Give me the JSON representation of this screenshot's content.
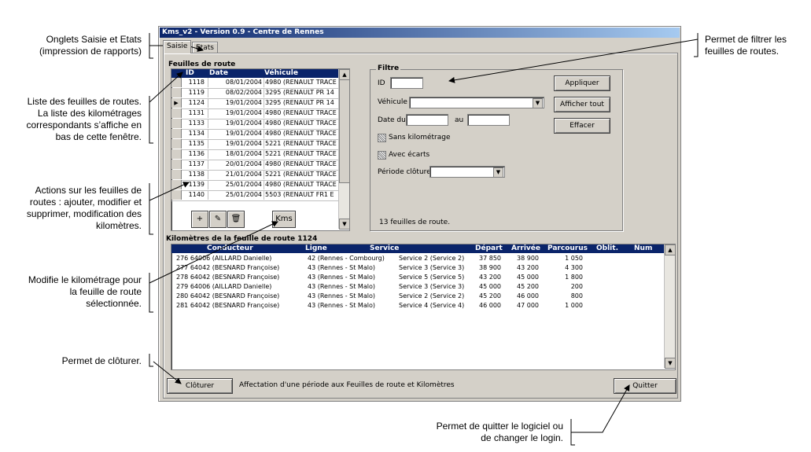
{
  "callouts": {
    "onglets": [
      "Onglets Saisie et Etats",
      "(impression de rapports)"
    ],
    "liste": [
      "Liste des feuilles de routes.",
      "La liste des kilométrages",
      "correspondants s’affiche en",
      "bas de cette fenêtre."
    ],
    "actions": [
      "Actions sur les feuilles de",
      "routes : ajouter, modifier et",
      "supprimer, modification des",
      "kilomètres."
    ],
    "modifie": [
      "Modifie le kilométrage pour",
      "la feuille de route",
      "sélectionnée."
    ],
    "cloturer": [
      "Permet de clôturer."
    ],
    "filtrer": [
      "Permet de filtrer les",
      "feuilles de routes."
    ],
    "quitter": [
      "Permet de quitter le logiciel ou",
      "de changer le login."
    ]
  },
  "window": {
    "title": "Kms_v2 - Version 0.9 - Centre de Rennes",
    "tabs": [
      "Saisie",
      "Etats"
    ]
  },
  "feuilles": {
    "title": "Feuilles de route",
    "columns": [
      "ID",
      "Date",
      "Véhicule"
    ],
    "rows": [
      {
        "id": "1118",
        "date": "08/01/2004",
        "vehicule": "4980 (RENAULT TRACE"
      },
      {
        "id": "1119",
        "date": "08/02/2004",
        "vehicule": "3295 (RENAULT PR 14"
      },
      {
        "id": "1124",
        "date": "19/01/2004",
        "vehicule": "3295 (RENAULT PR 14"
      },
      {
        "id": "1131",
        "date": "19/01/2004",
        "vehicule": "4980 (RENAULT TRACE"
      },
      {
        "id": "1133",
        "date": "19/01/2004",
        "vehicule": "4980 (RENAULT TRACE"
      },
      {
        "id": "1134",
        "date": "19/01/2004",
        "vehicule": "4980 (RENAULT TRACE"
      },
      {
        "id": "1135",
        "date": "19/01/2004",
        "vehicule": "5221 (RENAULT TRACE"
      },
      {
        "id": "1136",
        "date": "18/01/2004",
        "vehicule": "5221 (RENAULT TRACE"
      },
      {
        "id": "1137",
        "date": "20/01/2004",
        "vehicule": "4980 (RENAULT TRACE"
      },
      {
        "id": "1138",
        "date": "21/01/2004",
        "vehicule": "5221 (RENAULT TRACE"
      },
      {
        "id": "1139",
        "date": "25/01/2004",
        "vehicule": "4980 (RENAULT TRACE"
      },
      {
        "id": "1140",
        "date": "25/01/2004",
        "vehicule": "5503 (RENAULT FR1 E"
      }
    ],
    "tools": {
      "add": "+",
      "edit": "✎",
      "delete": "🗑",
      "kms": "Kms"
    }
  },
  "filtre": {
    "title": "Filtre",
    "id_label": "ID",
    "vehicule_label": "Véhicule",
    "date_du_label": "Date du",
    "au_label": "au",
    "sans_km": "Sans kilométrage",
    "avec_ecarts": "Avec écarts",
    "periode_label": "Période clôture",
    "count": "13 feuilles de route.",
    "appliquer": "Appliquer",
    "afficher_tout": "Afficher tout",
    "effacer": "Effacer"
  },
  "km": {
    "title": "Kilomètres de la feuille de route 1124",
    "columns": [
      "Conducteur",
      "Ligne",
      "Service",
      "Départ",
      "Arrivée",
      "Parcourus",
      "Oblit.",
      "Num BC"
    ],
    "rows": [
      {
        "cond": "276 64006 (AILLARD Danielle)",
        "ligne": "42 (Rennes - Combourg)",
        "service": "Service 2 (Service 2)",
        "depart": "37 850",
        "arrivee": "38 900",
        "parcourus": "1 050"
      },
      {
        "cond": "277 64042 (BESNARD Françoise)",
        "ligne": "43 (Rennes - St Malo)",
        "service": "Service 3 (Service 3)",
        "depart": "38 900",
        "arrivee": "43 200",
        "parcourus": "4 300"
      },
      {
        "cond": "278 64042 (BESNARD Françoise)",
        "ligne": "43 (Rennes - St Malo)",
        "service": "Service 5 (Service 5)",
        "depart": "43 200",
        "arrivee": "45 000",
        "parcourus": "1 800"
      },
      {
        "cond": "279 64006 (AILLARD Danielle)",
        "ligne": "43 (Rennes - St Malo)",
        "service": "Service 3 (Service 3)",
        "depart": "45 000",
        "arrivee": "45 200",
        "parcourus": "200"
      },
      {
        "cond": "280 64042 (BESNARD Françoise)",
        "ligne": "43 (Rennes - St Malo)",
        "service": "Service 2 (Service 2)",
        "depart": "45 200",
        "arrivee": "46 000",
        "parcourus": "800"
      },
      {
        "cond": "281 64042 (BESNARD Françoise)",
        "ligne": "43 (Rennes - St Malo)",
        "service": "Service 4 (Service 4)",
        "depart": "46 000",
        "arrivee": "47 000",
        "parcourus": "1 000"
      }
    ]
  },
  "bottom": {
    "cloturer": "Clôturer",
    "status": "Affectation d'une période aux Feuilles de route et Kilomètres",
    "quitter": "Quitter"
  }
}
